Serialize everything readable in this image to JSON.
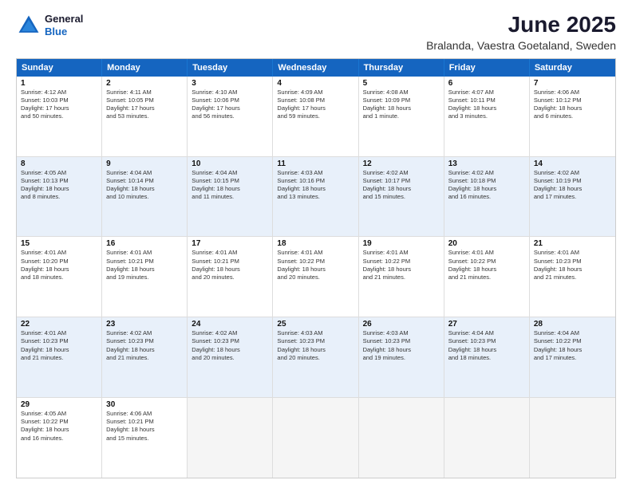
{
  "header": {
    "logo_line1": "General",
    "logo_line2": "Blue",
    "month": "June 2025",
    "location": "Bralanda, Vaestra Goetaland, Sweden"
  },
  "days_of_week": [
    "Sunday",
    "Monday",
    "Tuesday",
    "Wednesday",
    "Thursday",
    "Friday",
    "Saturday"
  ],
  "rows": [
    [
      {
        "day": "1",
        "info": "Sunrise: 4:12 AM\nSunset: 10:03 PM\nDaylight: 17 hours\nand 50 minutes."
      },
      {
        "day": "2",
        "info": "Sunrise: 4:11 AM\nSunset: 10:05 PM\nDaylight: 17 hours\nand 53 minutes."
      },
      {
        "day": "3",
        "info": "Sunrise: 4:10 AM\nSunset: 10:06 PM\nDaylight: 17 hours\nand 56 minutes."
      },
      {
        "day": "4",
        "info": "Sunrise: 4:09 AM\nSunset: 10:08 PM\nDaylight: 17 hours\nand 59 minutes."
      },
      {
        "day": "5",
        "info": "Sunrise: 4:08 AM\nSunset: 10:09 PM\nDaylight: 18 hours\nand 1 minute."
      },
      {
        "day": "6",
        "info": "Sunrise: 4:07 AM\nSunset: 10:11 PM\nDaylight: 18 hours\nand 3 minutes."
      },
      {
        "day": "7",
        "info": "Sunrise: 4:06 AM\nSunset: 10:12 PM\nDaylight: 18 hours\nand 6 minutes."
      }
    ],
    [
      {
        "day": "8",
        "info": "Sunrise: 4:05 AM\nSunset: 10:13 PM\nDaylight: 18 hours\nand 8 minutes."
      },
      {
        "day": "9",
        "info": "Sunrise: 4:04 AM\nSunset: 10:14 PM\nDaylight: 18 hours\nand 10 minutes."
      },
      {
        "day": "10",
        "info": "Sunrise: 4:04 AM\nSunset: 10:15 PM\nDaylight: 18 hours\nand 11 minutes."
      },
      {
        "day": "11",
        "info": "Sunrise: 4:03 AM\nSunset: 10:16 PM\nDaylight: 18 hours\nand 13 minutes."
      },
      {
        "day": "12",
        "info": "Sunrise: 4:02 AM\nSunset: 10:17 PM\nDaylight: 18 hours\nand 15 minutes."
      },
      {
        "day": "13",
        "info": "Sunrise: 4:02 AM\nSunset: 10:18 PM\nDaylight: 18 hours\nand 16 minutes."
      },
      {
        "day": "14",
        "info": "Sunrise: 4:02 AM\nSunset: 10:19 PM\nDaylight: 18 hours\nand 17 minutes."
      }
    ],
    [
      {
        "day": "15",
        "info": "Sunrise: 4:01 AM\nSunset: 10:20 PM\nDaylight: 18 hours\nand 18 minutes."
      },
      {
        "day": "16",
        "info": "Sunrise: 4:01 AM\nSunset: 10:21 PM\nDaylight: 18 hours\nand 19 minutes."
      },
      {
        "day": "17",
        "info": "Sunrise: 4:01 AM\nSunset: 10:21 PM\nDaylight: 18 hours\nand 20 minutes."
      },
      {
        "day": "18",
        "info": "Sunrise: 4:01 AM\nSunset: 10:22 PM\nDaylight: 18 hours\nand 20 minutes."
      },
      {
        "day": "19",
        "info": "Sunrise: 4:01 AM\nSunset: 10:22 PM\nDaylight: 18 hours\nand 21 minutes."
      },
      {
        "day": "20",
        "info": "Sunrise: 4:01 AM\nSunset: 10:22 PM\nDaylight: 18 hours\nand 21 minutes."
      },
      {
        "day": "21",
        "info": "Sunrise: 4:01 AM\nSunset: 10:23 PM\nDaylight: 18 hours\nand 21 minutes."
      }
    ],
    [
      {
        "day": "22",
        "info": "Sunrise: 4:01 AM\nSunset: 10:23 PM\nDaylight: 18 hours\nand 21 minutes."
      },
      {
        "day": "23",
        "info": "Sunrise: 4:02 AM\nSunset: 10:23 PM\nDaylight: 18 hours\nand 21 minutes."
      },
      {
        "day": "24",
        "info": "Sunrise: 4:02 AM\nSunset: 10:23 PM\nDaylight: 18 hours\nand 20 minutes."
      },
      {
        "day": "25",
        "info": "Sunrise: 4:03 AM\nSunset: 10:23 PM\nDaylight: 18 hours\nand 20 minutes."
      },
      {
        "day": "26",
        "info": "Sunrise: 4:03 AM\nSunset: 10:23 PM\nDaylight: 18 hours\nand 19 minutes."
      },
      {
        "day": "27",
        "info": "Sunrise: 4:04 AM\nSunset: 10:23 PM\nDaylight: 18 hours\nand 18 minutes."
      },
      {
        "day": "28",
        "info": "Sunrise: 4:04 AM\nSunset: 10:22 PM\nDaylight: 18 hours\nand 17 minutes."
      }
    ],
    [
      {
        "day": "29",
        "info": "Sunrise: 4:05 AM\nSunset: 10:22 PM\nDaylight: 18 hours\nand 16 minutes."
      },
      {
        "day": "30",
        "info": "Sunrise: 4:06 AM\nSunset: 10:21 PM\nDaylight: 18 hours\nand 15 minutes."
      },
      {
        "day": "",
        "info": ""
      },
      {
        "day": "",
        "info": ""
      },
      {
        "day": "",
        "info": ""
      },
      {
        "day": "",
        "info": ""
      },
      {
        "day": "",
        "info": ""
      }
    ]
  ]
}
